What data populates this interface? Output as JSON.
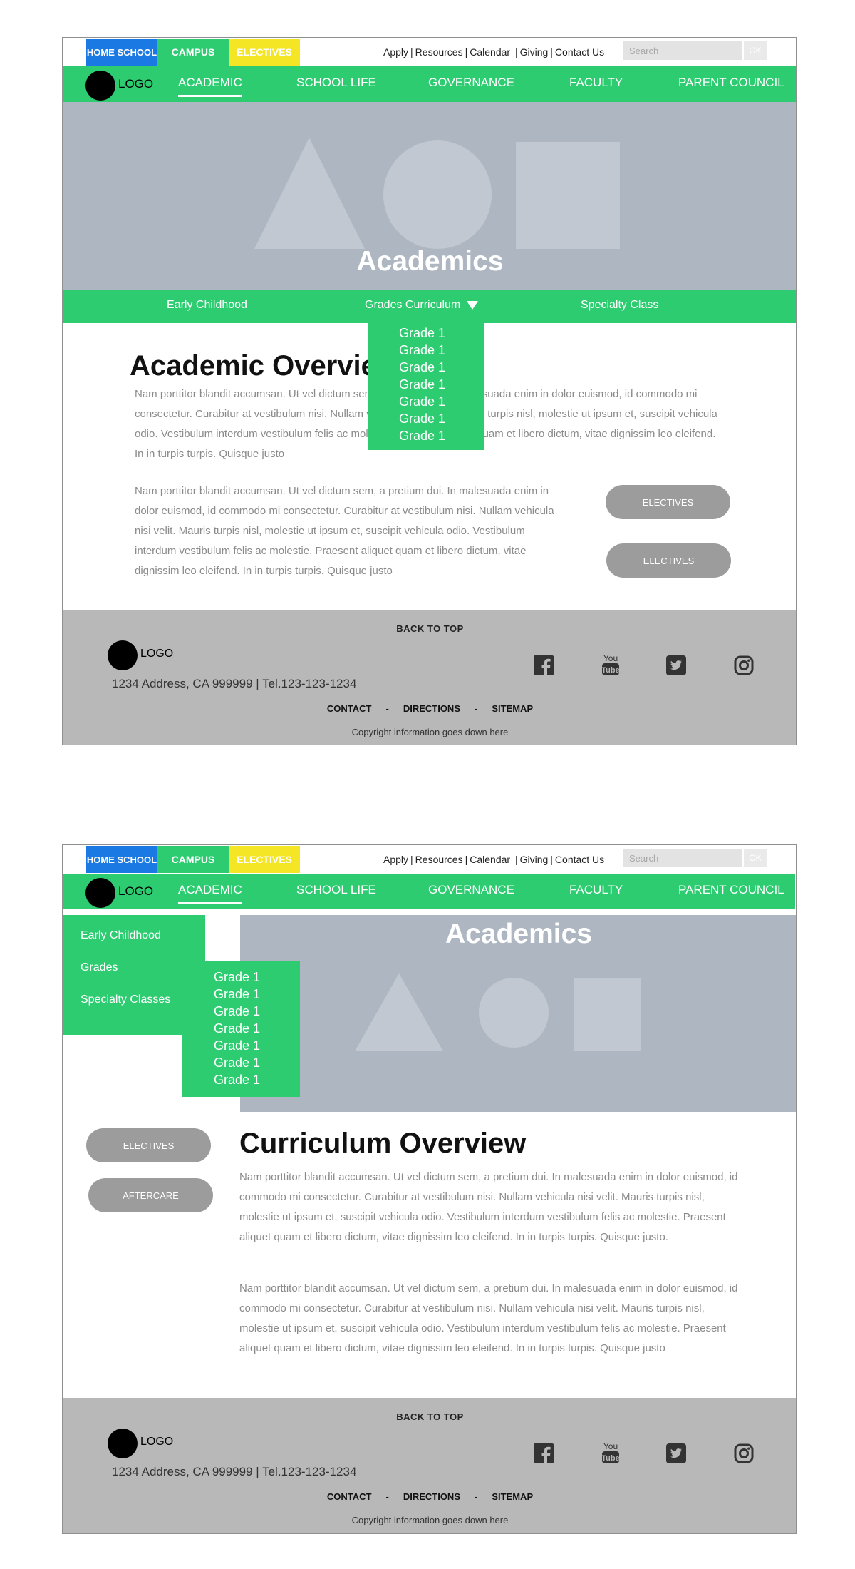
{
  "header": {
    "tabs": [
      "HOME SCHOOL",
      "CAMPUS",
      "ELECTIVES"
    ],
    "util_links": [
      "Apply",
      "Resources",
      "Calendar",
      "Giving",
      "Contact Us"
    ],
    "search_placeholder": "Search",
    "search_button": "OK",
    "logo_text": "LOGO",
    "nav": [
      "ACADEMIC",
      "SCHOOL LIFE",
      "GOVERNANCE",
      "FACULTY",
      "PARENT COUNCIL"
    ],
    "active_nav": "ACADEMIC"
  },
  "page1": {
    "hero_title": "Academics",
    "subnav": [
      "Early Childhood",
      "Grades Curriculum",
      "Specialty Class"
    ],
    "grades_dropdown": [
      "Grade 1",
      "Grade 1",
      "Grade 1",
      "Grade 1",
      "Grade 1",
      "Grade 1",
      "Grade 1"
    ],
    "overview_title": "Academic Overview",
    "para1": "Nam porttitor blandit accumsan. Ut vel dictum sem, a pretium dui. In malesuada enim in dolor euismod, id commodo mi consectetur. Curabitur at vestibulum nisi. Nullam vehicula nisi velit. Mauris turpis nisl, molestie ut ipsum et, suscipit vehicula odio. Vestibulum interdum vestibulum felis ac molestie. Praesent aliquet quam et libero dictum, vitae dignissim leo eleifend. In in turpis turpis. Quisque justo",
    "para2": "Nam porttitor blandit accumsan. Ut vel dictum sem, a pretium dui. In malesuada enim in dolor euismod, id commodo mi consectetur. Curabitur at vestibulum nisi. Nullam vehicula nisi velit. Mauris turpis nisl, molestie ut ipsum et, suscipit vehicula odio. Vestibulum interdum vestibulum felis ac molestie. Praesent aliquet quam et libero dictum, vitae dignissim leo eleifend. In in turpis turpis. Quisque justo",
    "buttons": [
      "ELECTIVES",
      "ELECTIVES"
    ]
  },
  "page2": {
    "hero_title": "Academics",
    "side_menu": [
      "Early Childhood",
      "Grades",
      "Specialty Classes"
    ],
    "grades_dropdown": [
      "Grade 1",
      "Grade 1",
      "Grade 1",
      "Grade 1",
      "Grade 1",
      "Grade 1",
      "Grade 1"
    ],
    "buttons": [
      "ELECTIVES",
      "AFTERCARE"
    ],
    "overview_title": "Curriculum Overview",
    "para1": "Nam porttitor blandit accumsan. Ut vel dictum sem, a pretium dui. In malesuada enim in dolor euismod, id commodo mi consectetur. Curabitur at vestibulum nisi. Nullam vehicula nisi velit. Mauris turpis nisl, molestie ut ipsum et, suscipit vehicula odio. Vestibulum interdum vestibulum felis ac molestie. Praesent aliquet quam et libero dictum, vitae dignissim leo eleifend. In in turpis turpis. Quisque justo.",
    "para2": "Nam porttitor blandit accumsan. Ut vel dictum sem, a pretium dui. In malesuada enim in dolor euismod, id commodo mi consectetur. Curabitur at vestibulum nisi. Nullam vehicula nisi velit. Mauris turpis nisl, molestie ut ipsum et, suscipit vehicula odio. Vestibulum interdum vestibulum felis ac molestie. Praesent aliquet quam et libero dictum, vitae dignissim leo eleifend. In in turpis turpis. Quisque justo"
  },
  "footer": {
    "back_to_top": "BACK TO TOP",
    "logo_text": "LOGO",
    "address": "1234 Address, CA 999999 |  Tel.123-123-1234",
    "social_icons": [
      "facebook-icon",
      "youtube-icon",
      "twitter-icon",
      "instagram-icon"
    ],
    "youtube_top": "You",
    "youtube_bottom": "Tube",
    "links": [
      "CONTACT",
      "DIRECTIONS",
      "SITEMAP"
    ],
    "link_separator": "-",
    "copyright": "Copyright information goes down here"
  },
  "colors": {
    "green": "#2ecc71",
    "blue": "#1a79e3",
    "yellow": "#f5e625",
    "hero": "#aeb7c1",
    "footer": "#b8b8b8",
    "pill": "#9c9c9c"
  }
}
